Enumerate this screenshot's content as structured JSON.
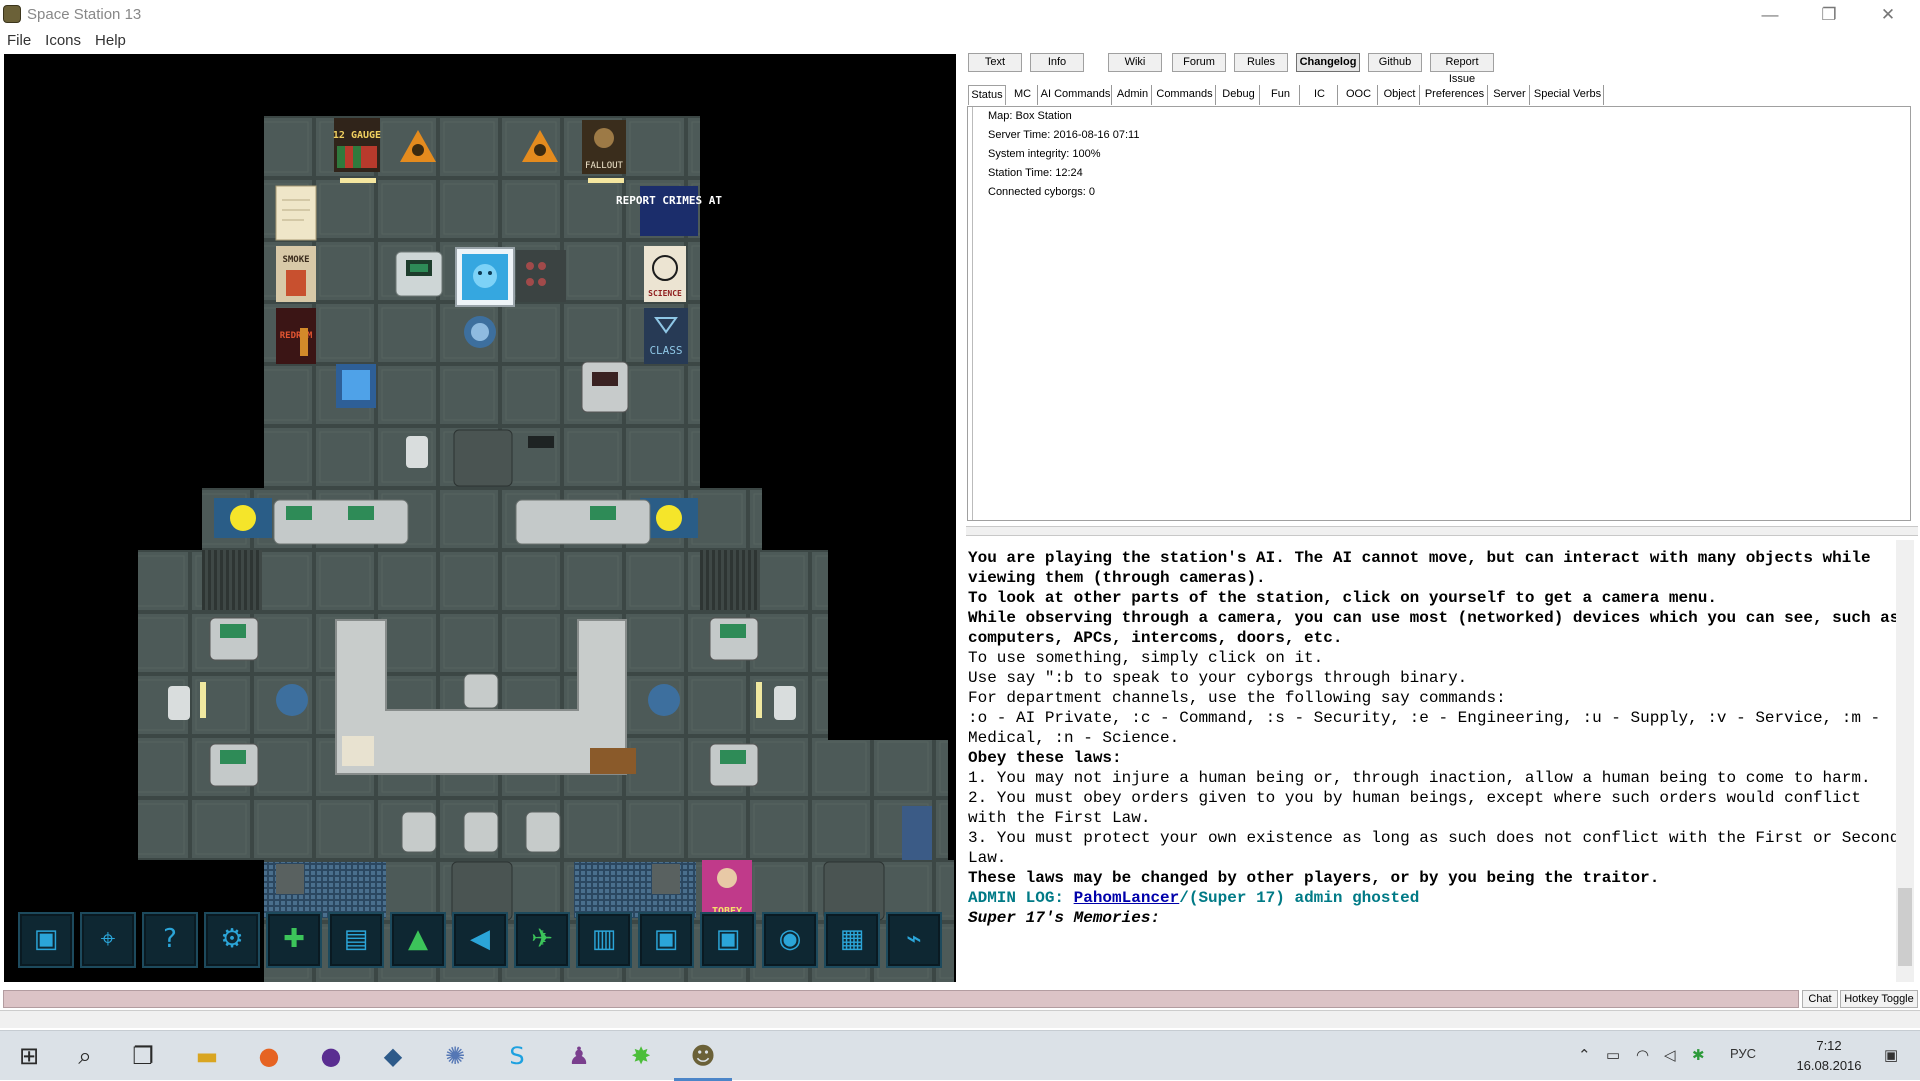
{
  "window": {
    "title": "Space Station 13",
    "icon": "ss13-icon",
    "controls": [
      "—",
      "❐",
      "✕"
    ]
  },
  "menu": [
    "File",
    "Icons",
    "Help"
  ],
  "top_buttons": [
    {
      "label": "Text",
      "bold": false
    },
    {
      "label": "Info",
      "bold": false
    },
    {
      "label": "Wiki",
      "bold": false
    },
    {
      "label": "Forum",
      "bold": false
    },
    {
      "label": "Rules",
      "bold": false
    },
    {
      "label": "Changelog",
      "bold": true
    },
    {
      "label": "Github",
      "bold": false
    },
    {
      "label": "Report Issue",
      "bold": false
    }
  ],
  "tabs": [
    "Status",
    "MC",
    "AI Commands",
    "Admin",
    "Commands",
    "Debug",
    "Fun",
    "IC",
    "OOC",
    "Object",
    "Preferences",
    "Server",
    "Special Verbs"
  ],
  "active_tab": "Status",
  "status": [
    "Map: Box Station",
    "Server Time: 2016-08-16 07:11",
    "System integrity: 100%",
    "Station Time: 12:24",
    "Connected cyborgs: 0"
  ],
  "output": {
    "intro": [
      "You are playing the station's AI. The AI cannot move, but can interact with many objects while viewing them (through cameras).",
      "To look at other parts of the station, click on yourself to get a camera menu.",
      "While observing through a camera, you can use most (networked) devices which you can see, such as computers, APCs, intercoms, doors, etc."
    ],
    "plain": [
      "To use something, simply click on it.",
      "Use say \":b to speak to your cyborgs through binary.",
      "For department channels, use the following say commands:",
      ":o - AI Private, :c - Command, :s - Security, :e - Engineering, :u - Supply, :v - Service, :m - Medical, :n - Science."
    ],
    "laws_header": "Obey these laws:",
    "laws": [
      "1. You may not injure a human being or, through inaction, allow a human being to come to harm.",
      "2. You must obey orders given to you by human beings, except where such orders would conflict with the First Law.",
      "3. You must protect your own existence as long as such does not conflict with the First or Second Law."
    ],
    "laws_footer": "These laws may be changed by other players, or by you being the traitor.",
    "admin_prefix": "ADMIN LOG: ",
    "admin_name": "PahomLancer",
    "admin_suffix": "/(Super 17) admin ghosted",
    "memories": "Super 17's Memories:"
  },
  "input": {
    "chat_label": "Chat",
    "hotkey_label": "Hotkey Toggle"
  },
  "map_signs": {
    "gauge": "12 GAUGE",
    "fallout": "FALLOUT",
    "report": "REPORT CRIMES AT",
    "smoke": "SMOKE",
    "science": "SCIENCE",
    "redrum": "REDRUM",
    "class": "CLASS",
    "tobey": "TOBEY"
  },
  "hud_icons": [
    "core-icon",
    "camera-icon",
    "camera-list-icon",
    "camera-track-icon",
    "crew-monitor-icon",
    "manifest-icon",
    "alerts-icon",
    "announcement-icon",
    "call-shuttle-icon",
    "status-icon",
    "pda-icon",
    "photo-icon",
    "camera-light-icon",
    "image-icon",
    "sensor-icon"
  ],
  "taskbar": {
    "apps": [
      "start-icon",
      "search-icon",
      "task-view-icon",
      "file-explorer-icon",
      "firefox-icon",
      "github-icon",
      "visual-studio-icon",
      "network-icon",
      "skype-icon",
      "byond-icon",
      "cheat-icon",
      "ss13-icon"
    ],
    "lang": "РУС",
    "time": "7:12",
    "date": "16.08.2016"
  },
  "colors": {
    "floor": "#4d5a58",
    "floor_line": "#3c4745",
    "terminal_green": "#2e8b57",
    "ai_blue": "#35a7e0",
    "chat_input": "#dcc3c6",
    "admin": "#007a86"
  }
}
